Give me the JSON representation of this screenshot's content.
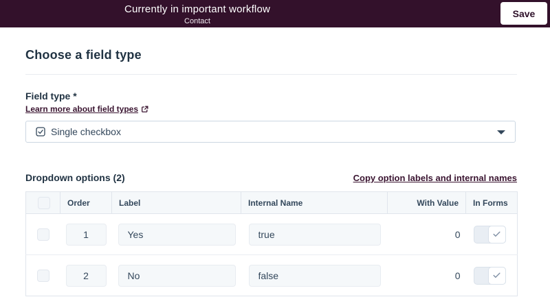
{
  "header": {
    "title": "Currently in important workflow",
    "subtitle": "Contact",
    "save_label": "Save",
    "bg_color": "#33112b"
  },
  "main": {
    "heading": "Choose a field type",
    "field_type": {
      "label": "Field type *",
      "learn_more_link": "Learn more about field types",
      "selected_value": "Single checkbox"
    },
    "options_section": {
      "title": "Dropdown options (2)",
      "copy_link": "Copy option labels and internal names"
    },
    "table": {
      "columns": {
        "order": "Order",
        "label": "Label",
        "internal_name": "Internal Name",
        "with_value": "With Value",
        "in_forms": "In Forms"
      },
      "rows": [
        {
          "order": "1",
          "label": "Yes",
          "internal_name": "true",
          "with_value": "0",
          "in_forms_checked": true
        },
        {
          "order": "2",
          "label": "No",
          "internal_name": "false",
          "with_value": "0",
          "in_forms_checked": true
        }
      ]
    }
  },
  "icons": {
    "field_option": "single-checkbox-icon",
    "learn_more": "external-link-icon",
    "select": "caret-down-icon",
    "in_forms": "checkmark-icon"
  },
  "colors": {
    "banner_bg": "#33112b",
    "link": "#3a1430",
    "heading_text": "#213343",
    "body_text": "#33475b",
    "table_header_bg": "#f5f8fa",
    "input_bg": "#f5f8fa",
    "border": "#cbd6e2"
  }
}
